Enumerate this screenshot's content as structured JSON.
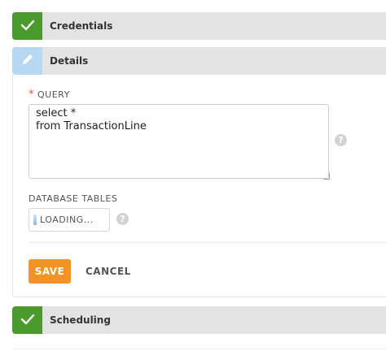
{
  "sections": {
    "credentials": {
      "title": "Credentials",
      "status": "check-icon"
    },
    "details": {
      "title": "Details",
      "status": "pencil-icon"
    },
    "scheduling": {
      "title": "Scheduling",
      "status": "check-icon"
    }
  },
  "query": {
    "required_marker": "*",
    "label": "QUERY",
    "value": "select *\nfrom TransactionLine",
    "help": "?"
  },
  "database_tables": {
    "label": "DATABASE TABLES",
    "loading_text": "LOADING...",
    "help": "?"
  },
  "actions": {
    "save_label": "SAVE",
    "cancel_label": "CANCEL"
  },
  "colors": {
    "done": "#4a9a2c",
    "editing": "#b8d8f2",
    "save_button": "#f29423",
    "required": "#d9534f"
  }
}
